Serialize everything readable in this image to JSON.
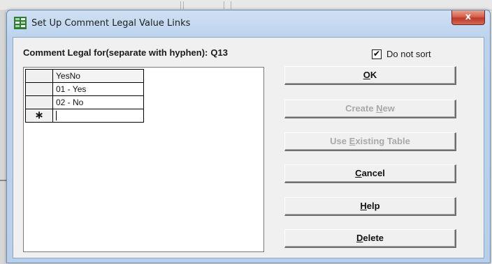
{
  "window": {
    "title": "Set Up Comment Legal Value Links",
    "close_symbol": "x"
  },
  "form": {
    "label": "Comment Legal for(separate with hyphen):",
    "value": "Q13"
  },
  "sort_checkbox": {
    "label": "Do not sort",
    "checked": true,
    "check_mark": "✔"
  },
  "grid": {
    "header": "YesNo",
    "rows": [
      {
        "value": "01 - Yes"
      },
      {
        "value": "02 - No"
      }
    ],
    "new_row_marker": "∗",
    "new_row_value": ""
  },
  "buttons": {
    "ok": {
      "pre": "",
      "key": "O",
      "post": "K",
      "enabled": true
    },
    "create_new": {
      "pre": "Create ",
      "key": "N",
      "post": "ew",
      "enabled": false
    },
    "use_existing": {
      "pre": "Use ",
      "key": "E",
      "post": "xisting Table",
      "enabled": false
    },
    "cancel": {
      "pre": "",
      "key": "C",
      "post": "ancel",
      "enabled": true
    },
    "help": {
      "pre": "",
      "key": "H",
      "post": "elp",
      "enabled": true
    },
    "delete": {
      "pre": "",
      "key": "D",
      "post": "elete",
      "enabled": true
    }
  },
  "icons": {
    "app": "grid-app-icon",
    "close": "close-icon",
    "checkmark": "checkmark-icon",
    "new_row": "asterisk-icon"
  },
  "colors": {
    "title_bar": "#bcd3ee",
    "close_button": "#c0392b",
    "disabled_text": "#a8a8a8",
    "client_bg": "#f0f0f0"
  }
}
